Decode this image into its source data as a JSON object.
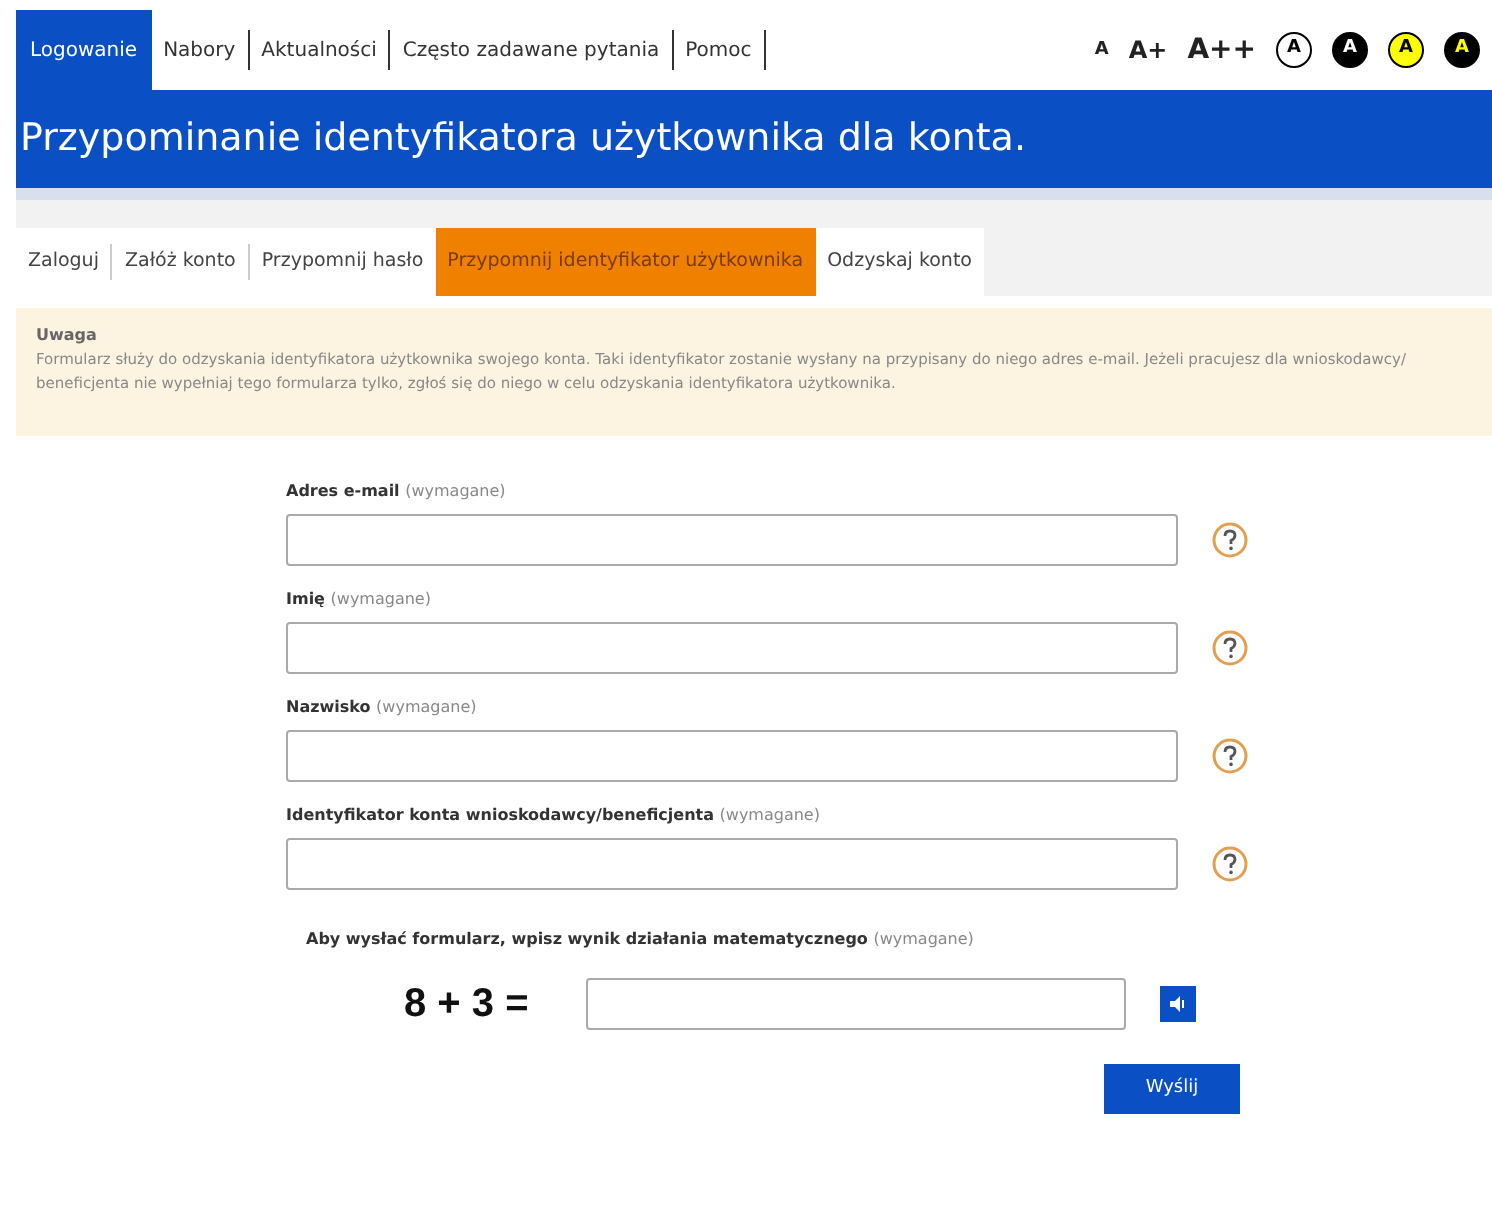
{
  "top_nav": [
    {
      "label": "Logowanie",
      "selected": true
    },
    {
      "label": "Nabory",
      "selected": false
    },
    {
      "label": "Aktualności",
      "selected": false
    },
    {
      "label": "Często zadawane pytania",
      "selected": false
    },
    {
      "label": "Pomoc",
      "selected": false
    }
  ],
  "font_sizes": [
    {
      "label": "A",
      "kind": "small"
    },
    {
      "label": "A+",
      "kind": "medium"
    },
    {
      "label": "A++",
      "kind": "large"
    }
  ],
  "contrast_options": [
    {
      "label": "A",
      "kind": "default"
    },
    {
      "label": "A",
      "kind": "black-white"
    },
    {
      "label": "A",
      "kind": "yellow-black"
    },
    {
      "label": "A",
      "kind": "black-yellow"
    }
  ],
  "page_title": "Przypominanie identyfikatora użytkownika dla konta.",
  "tabs": [
    {
      "label": "Zaloguj",
      "selected": false
    },
    {
      "label": "Załóż konto",
      "selected": false
    },
    {
      "label": "Przypomnij hasło",
      "selected": false
    },
    {
      "label": "Przypomnij identyfikator użytkownika",
      "selected": true
    },
    {
      "label": "Odzyskaj konto",
      "selected": false
    }
  ],
  "notice": {
    "title": "Uwaga",
    "text": "Formularz służy do odzyskania identyfikatora użytkownika swojego konta. Taki identyfikator zostanie wysłany na przypisany do niego adres e-mail. Jeżeli pracujesz dla wnioskodawcy/ beneficjenta nie wypełniaj tego formularza tylko, zgłoś się do niego w celu odzyskania identyfikatora użytkownika."
  },
  "fields": [
    {
      "label": "Adres e-mail",
      "required": "(wymagane)"
    },
    {
      "label": "Imię",
      "required": "(wymagane)"
    },
    {
      "label": "Nazwisko",
      "required": "(wymagane)"
    },
    {
      "label": "Identyfikator konta wnioskodawcy/beneficjenta",
      "required": "(wymagane)"
    }
  ],
  "captcha": {
    "label": "Aby wysłać formularz, wpisz wynik działania matematycznego",
    "required": "(wymagane)",
    "question": "8 + 3 ="
  },
  "submit": "Wyślij"
}
